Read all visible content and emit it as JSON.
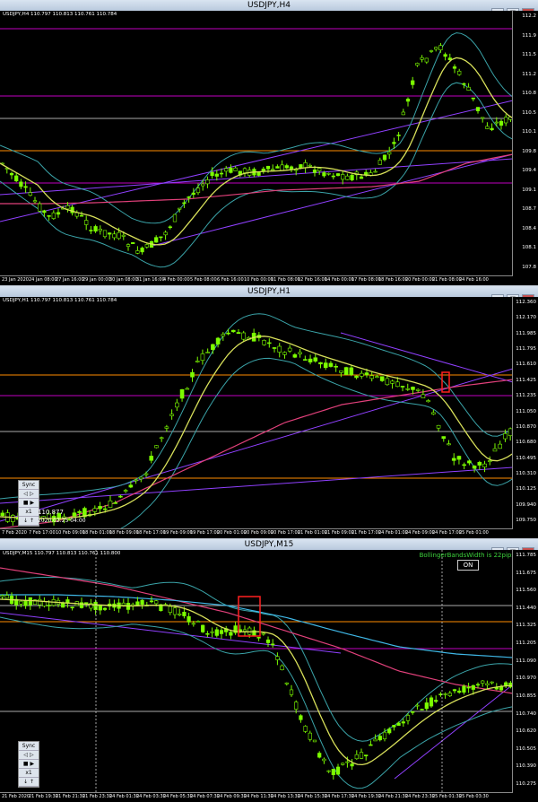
{
  "windows": [
    {
      "title": "USDJPY,H4",
      "info": "USDJPY,H4  110.797 110.813 110.761 110.784",
      "y_ticks": [
        "112.2",
        "111.9",
        "111.5",
        "111.2",
        "110.8",
        "110.5",
        "110.1",
        "109.8",
        "109.4",
        "109.1",
        "108.7",
        "108.4",
        "108.1",
        "107.8"
      ],
      "x_ticks": [
        "23 Jan 2020",
        "24 Jan 08:00",
        "27 Jan 16:00",
        "29 Jan 00:00",
        "30 Jan 08:00",
        "31 Jan 16:00",
        "4 Feb 00:00",
        "5 Feb 08:00",
        "6 Feb 16:00",
        "10 Feb 00:00",
        "11 Feb 08:00",
        "12 Feb 16:00",
        "14 Feb 00:00",
        "17 Feb 08:00",
        "18 Feb 16:00",
        "20 Feb 00:00",
        "21 Feb 08:00",
        "24 Feb 16:00"
      ]
    },
    {
      "title": "USDJPY,H1",
      "info": "USDJPY,H1  110.797 110.813 110.761 110.784",
      "y_ticks": [
        "112.360",
        "112.170",
        "111.985",
        "111.795",
        "111.610",
        "111.425",
        "111.235",
        "111.050",
        "110.870",
        "110.680",
        "110.495",
        "110.310",
        "110.125",
        "109.940",
        "109.750"
      ],
      "x_ticks": [
        "7 Feb 2020",
        "7 Feb 17:00",
        "10 Feb 09:00",
        "18 Feb 01:00",
        "18 Feb 09:00",
        "18 Feb 17:00",
        "19 Feb 09:00",
        "19 Feb 17:00",
        "20 Feb 01:00",
        "20 Feb 09:00",
        "20 Feb 17:00",
        "21 Feb 01:00",
        "21 Feb 09:00",
        "21 Feb 17:00",
        "24 Feb 01:00",
        "24 Feb 09:00",
        "24 Feb 17:00",
        "25 Feb 01:00"
      ],
      "crosshair_price": "110.877",
      "crosshair_time": "2020.02.25 04:00",
      "sync": {
        "label": "Sync",
        "buttons": [
          "◁",
          "▷",
          "■",
          "▶",
          "x1",
          "↓",
          "↑"
        ]
      }
    },
    {
      "title": "USDJPY,M15",
      "info": "USDJPY,M15  110.797 110.813 110.761 110.800",
      "indicator_label": "BollingerBandsWidth is 22pips",
      "on_label": "ON",
      "y_ticks": [
        "111.785",
        "111.675",
        "111.560",
        "111.440",
        "111.325",
        "111.205",
        "111.090",
        "110.970",
        "110.855",
        "110.740",
        "110.620",
        "110.505",
        "110.390",
        "110.275"
      ],
      "x_ticks": [
        "21 Feb 2020",
        "21 Feb 19:30",
        "21 Feb 21:30",
        "21 Feb 23:30",
        "24 Feb 01:30",
        "24 Feb 03:30",
        "24 Feb 05:30",
        "24 Feb 07:30",
        "24 Feb 09:30",
        "24 Feb 11:30",
        "24 Feb 13:30",
        "24 Feb 15:30",
        "24 Feb 17:30",
        "24 Feb 19:30",
        "24 Feb 21:30",
        "24 Feb 23:30",
        "25 Feb 01:30",
        "25 Feb 03:30"
      ],
      "sync": {
        "label": "Sync",
        "buttons": [
          "◁",
          "▷",
          "■",
          "▶",
          "x1",
          "↓",
          "↑"
        ]
      }
    }
  ],
  "colors": {
    "background": "#000000",
    "candle": "#7CFC00",
    "ma_yellow": "#d8e05a",
    "bands": "#3aa3a8",
    "ma_red": "#e0407a",
    "ma_blue": "#3fb7e6",
    "level_orange": "#ff8c00",
    "level_violet": "#c000c0",
    "trend_purple": "#9040ff",
    "box_red": "#ff2020"
  }
}
